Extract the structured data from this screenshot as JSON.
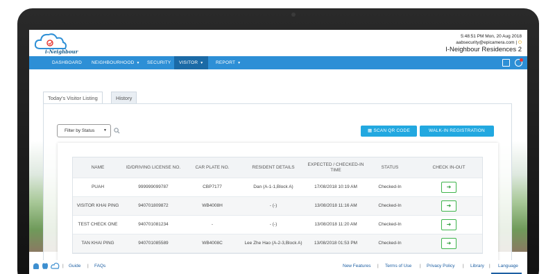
{
  "brand": {
    "logo_text": "i-Neighbour"
  },
  "header": {
    "time": "5:48:51 PM  Mon, 20 Aug 2018",
    "email": "aabsecurity@epicamera.com",
    "site": "I-Neighbour Residences 2"
  },
  "nav": {
    "dashboard": "DASHBOARD",
    "neighbourhood": "NEIGHBOURHOOD",
    "security": "SECURITY",
    "visitor": "VISITOR",
    "report": "REPORT"
  },
  "tabs": {
    "today": "Today's Visitor Listing",
    "history": "History"
  },
  "filter": {
    "label": "Filter by Status"
  },
  "buttons": {
    "scan": "SCAN QR CODE",
    "walkin": "WALK-IN REGISTRATION"
  },
  "table": {
    "headers": [
      "NAME",
      "ID/DRIVING LICENSE NO.",
      "CAR PLATE NO.",
      "RESIDENT DETAILS",
      "EXPECTED / CHECKED-IN TIME",
      "STATUS",
      "CHECK IN-OUT"
    ],
    "rows": [
      [
        "PUAH",
        "999999099787",
        "CBP7177",
        "Dan (A-1-1,Block A)",
        "17/08/2018 10:19 AM",
        "Checked-In"
      ],
      [
        "VISITOR KHAI PING",
        "940701809872",
        "WB4008H",
        "- (-)",
        "13/08/2018 11:16 AM",
        "Checked-In"
      ],
      [
        "TEST CHECK ONE",
        "940701081234",
        "-",
        "- (-)",
        "13/08/2018 11:20 AM",
        "Checked-In"
      ],
      [
        "TAN KHAI PING",
        "940701085589",
        "WB4008C",
        "Lee Zhe Hao (A-2-3,Block A)",
        "13/08/2018 01:53 PM",
        "Checked-In"
      ]
    ]
  },
  "footer": {
    "guide": "Guide",
    "faqs": "FAQs",
    "new_features": "New Features",
    "terms": "Terms of Use",
    "privacy": "Privacy Policy",
    "library": "Library",
    "language": "Language"
  },
  "colors": {
    "nav": "#2d8fd6",
    "nav_active": "#1b6aa6",
    "button": "#22a8e0",
    "check": "#3cb44a"
  }
}
